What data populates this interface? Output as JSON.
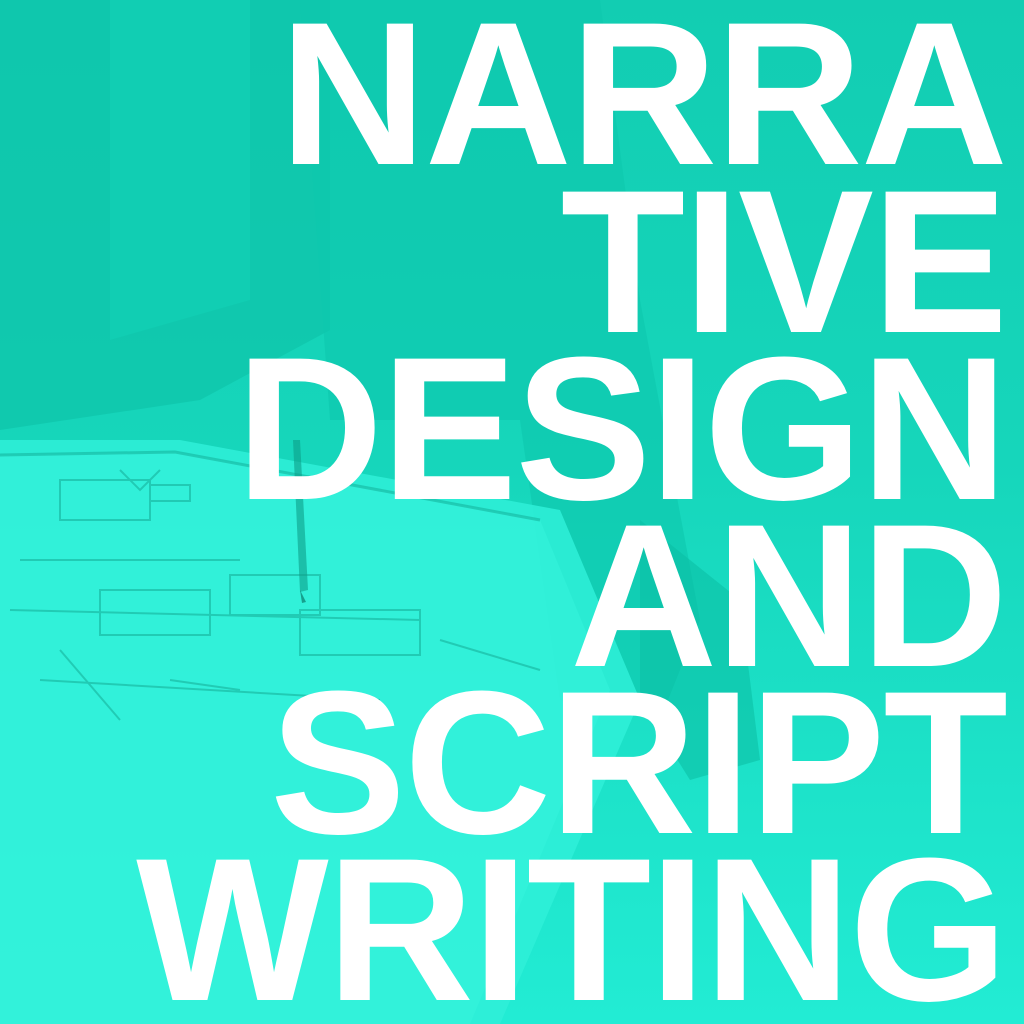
{
  "theme": {
    "tint_color": "#17dcc0",
    "text_color": "#ffffff"
  },
  "title": {
    "lines": [
      "NARRA",
      "TIVE",
      "DESIGN",
      "AND",
      "SCRIPT",
      "WRITING"
    ]
  },
  "background": {
    "icon": "storyboard-sketch-photo"
  }
}
